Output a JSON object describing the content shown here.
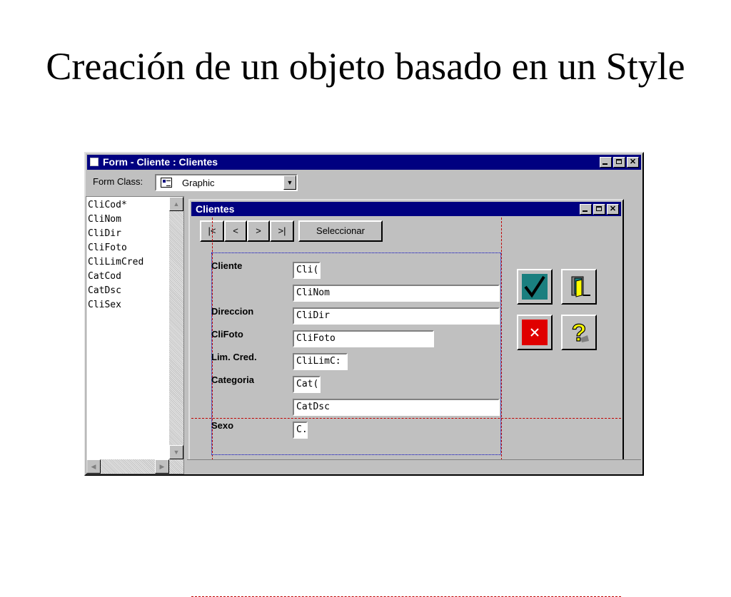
{
  "slide": {
    "title": "Creación de un objeto basado en un Style"
  },
  "outer_window": {
    "title": "Form - Cliente : Clientes",
    "form_class_label": "Form Class:",
    "form_class_value": "Graphic"
  },
  "attributes": [
    "CliCod*",
    "CliNom",
    "CliDir",
    "CliFoto",
    "CliLimCred",
    "CatCod",
    "CatDsc",
    "CliSex"
  ],
  "inner_window": {
    "title": "Clientes",
    "nav": {
      "first": "|<",
      "prev": "<",
      "next": ">",
      "last": ">|",
      "select": "Seleccionar"
    }
  },
  "fields": {
    "cliente_label": "Cliente",
    "clicod_value": "Cli(",
    "clinom_value": "CliNom",
    "direccion_label": "Direccion",
    "clidir_value": "CliDir",
    "clifoto_label": "CliFoto",
    "clifoto_value": "CliFoto",
    "limcred_label": "Lim. Cred.",
    "clilimcred_value": "CliLimC:",
    "categoria_label": "Categoria",
    "catcod_value": "Cat(",
    "catdsc_value": "CatDsc",
    "sexo_label": "Sexo",
    "clisex_value": "C."
  },
  "icons": {
    "confirm": "check-icon",
    "exit": "exit-door-icon",
    "cancel": "cancel-x-icon",
    "help": "help-question-icon"
  },
  "colors": {
    "titlebar": "#000080",
    "window_face": "#c0c0c0",
    "confirm_bg": "#1a7f7f",
    "cancel_bg": "#e00000",
    "help_yellow": "#ffff00",
    "guide_red": "#c00000",
    "frame_blue": "#0000c0"
  }
}
